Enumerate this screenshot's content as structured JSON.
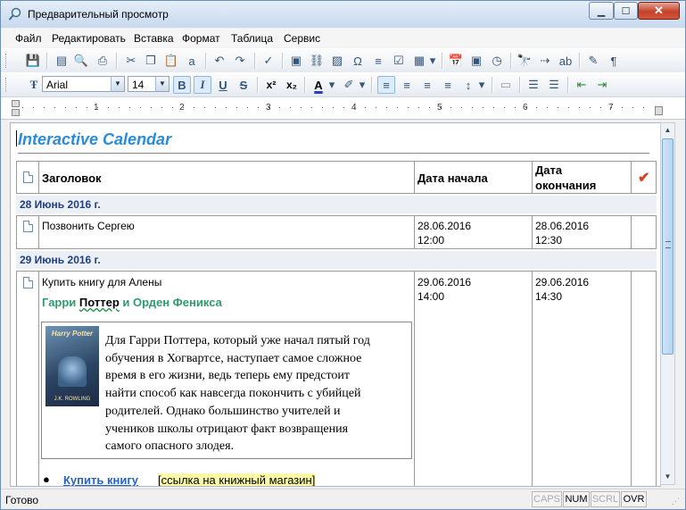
{
  "window": {
    "title": "Предварительный просмотр"
  },
  "menu": [
    "Файл",
    "Редактировать",
    "Вставка",
    "Формат",
    "Таблица",
    "Сервис"
  ],
  "toolbar": {
    "font_name": "Arial",
    "font_size": "14"
  },
  "ruler": {
    "marks": [
      "1",
      "2",
      "3",
      "4",
      "5",
      "6",
      "7"
    ]
  },
  "document": {
    "title": "Interactive Calendar",
    "columns": {
      "title": "Заголовок",
      "start": "Дата начала",
      "end_line1": "Дата",
      "end_line2": "окончания",
      "done": "✔"
    },
    "groups": [
      {
        "date": "28 Июнь 2016 г.",
        "task": "Позвонить Сергею",
        "start_date": "28.06.2016",
        "start_time": "12:00",
        "end_date": "28.06.2016",
        "end_time": "12:30"
      },
      {
        "date": "29 Июнь 2016 г.",
        "task": "Купить книгу для Алены",
        "start_date": "29.06.2016",
        "start_time": "14:00",
        "end_date": "29.06.2016",
        "end_time": "14:30"
      }
    ],
    "book": {
      "title_part1": "Гарри ",
      "title_part2": "Поттер",
      "title_part3": " и Орден Феникса",
      "cover_title": "Harry Potter",
      "cover_author": "J.K. ROWLING",
      "description_lines": [
        "Для Гарри Поттера, который уже начал пятый год",
        "обучения в Хогвартсе, наступает самое сложное",
        "время в его жизни, ведь теперь ему предстоит",
        "найти способ как навсегда покончить с убийцей",
        "родителей. Однако большинство учителей и",
        "учеников школы отрицают факт возвращения",
        "самого опасного злодея."
      ],
      "buy_link": "Купить книгу",
      "shop_link": "[ссылка на книжный магазин]"
    }
  },
  "status": {
    "text": "Готово",
    "indicators": [
      "CAPS",
      "NUM",
      "SCRL",
      "OVR"
    ]
  }
}
